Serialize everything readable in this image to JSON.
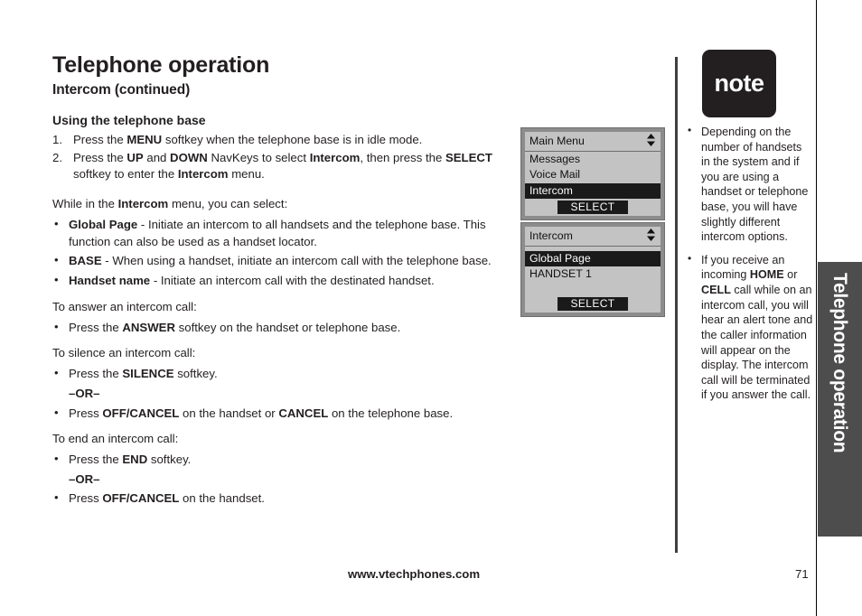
{
  "page": {
    "title": "Telephone operation",
    "subtitle": "Intercom (continued)"
  },
  "content": {
    "section_heading": "Using the telephone base",
    "steps": [
      {
        "num": "1.",
        "html": "Press the <b>MENU</b> softkey when the telephone base is in idle mode."
      },
      {
        "num": "2.",
        "html": "Press the <b>UP</b> and <b>DOWN</b> NavKeys to select <b>Intercom</b>, then press the <b>SELECT</b>&nbsp; softkey to enter the <b>Intercom</b> menu."
      }
    ],
    "intro_while": "While in the <b>Intercom</b> menu, you can select:",
    "option_bullets": [
      "<b>Global Page</b> - Initiate an intercom to all handsets and the telephone base. This function can also be used as a handset locator.",
      "<b>BASE</b> - When using a handset, initiate an intercom call with the telephone base.",
      "<b>Handset name</b> - Initiate an intercom call with the destinated handset."
    ],
    "answer_lead": "To answer an intercom call:",
    "answer_bullets": [
      "Press the <b>ANSWER</b> softkey on the handset or telephone base."
    ],
    "silence_lead": "To silence an intercom call:",
    "silence_bullets": [
      "Press the <b>SILENCE</b> softkey.",
      "–OR–",
      "Press <b>OFF/CANCEL</b> on the handset or <b>CANCEL</b> on the telephone base."
    ],
    "end_lead": "To end an intercom call:",
    "end_bullets": [
      "Press the <b>END</b> softkey.",
      "–OR–",
      "Press <b>OFF/CANCEL</b> on the handset."
    ]
  },
  "lcd_main_menu": {
    "header": "Main Menu",
    "arrow_icon": "⬍",
    "rows": [
      {
        "label": "Messages",
        "selected": false
      },
      {
        "label": "Voice Mail",
        "selected": false
      },
      {
        "label": "Intercom",
        "selected": true
      }
    ],
    "softkey": "SELECT"
  },
  "lcd_intercom": {
    "header": "Intercom",
    "arrow_icon": "⬍",
    "rows": [
      {
        "label": "Global Page",
        "selected": true
      },
      {
        "label": "HANDSET 1",
        "selected": false
      }
    ],
    "softkey": "SELECT"
  },
  "note": {
    "badge_label": "note",
    "items": [
      "Depending on the number of handsets in the system and if you are using a handset or telephone base, you will have slightly different intercom options.",
      "If you receive an incoming <b>HOME</b> or <b>CELL</b> call while on an intercom call, you will hear an alert tone and the caller information will appear on the display. The intercom call will be terminated if you answer the call."
    ]
  },
  "side_tab": {
    "label": "Telephone operation"
  },
  "footer": {
    "url": "www.vtechphones.com",
    "page_number": "71"
  },
  "colors": {
    "ink": "#231f20",
    "note_badge_bg": "#231f20",
    "side_tab_bg": "#4d4d4d",
    "lcd_frame": "#8c8c8c",
    "lcd_screen": "#c3c3c3",
    "lcd_highlight": "#1a1a1a"
  }
}
